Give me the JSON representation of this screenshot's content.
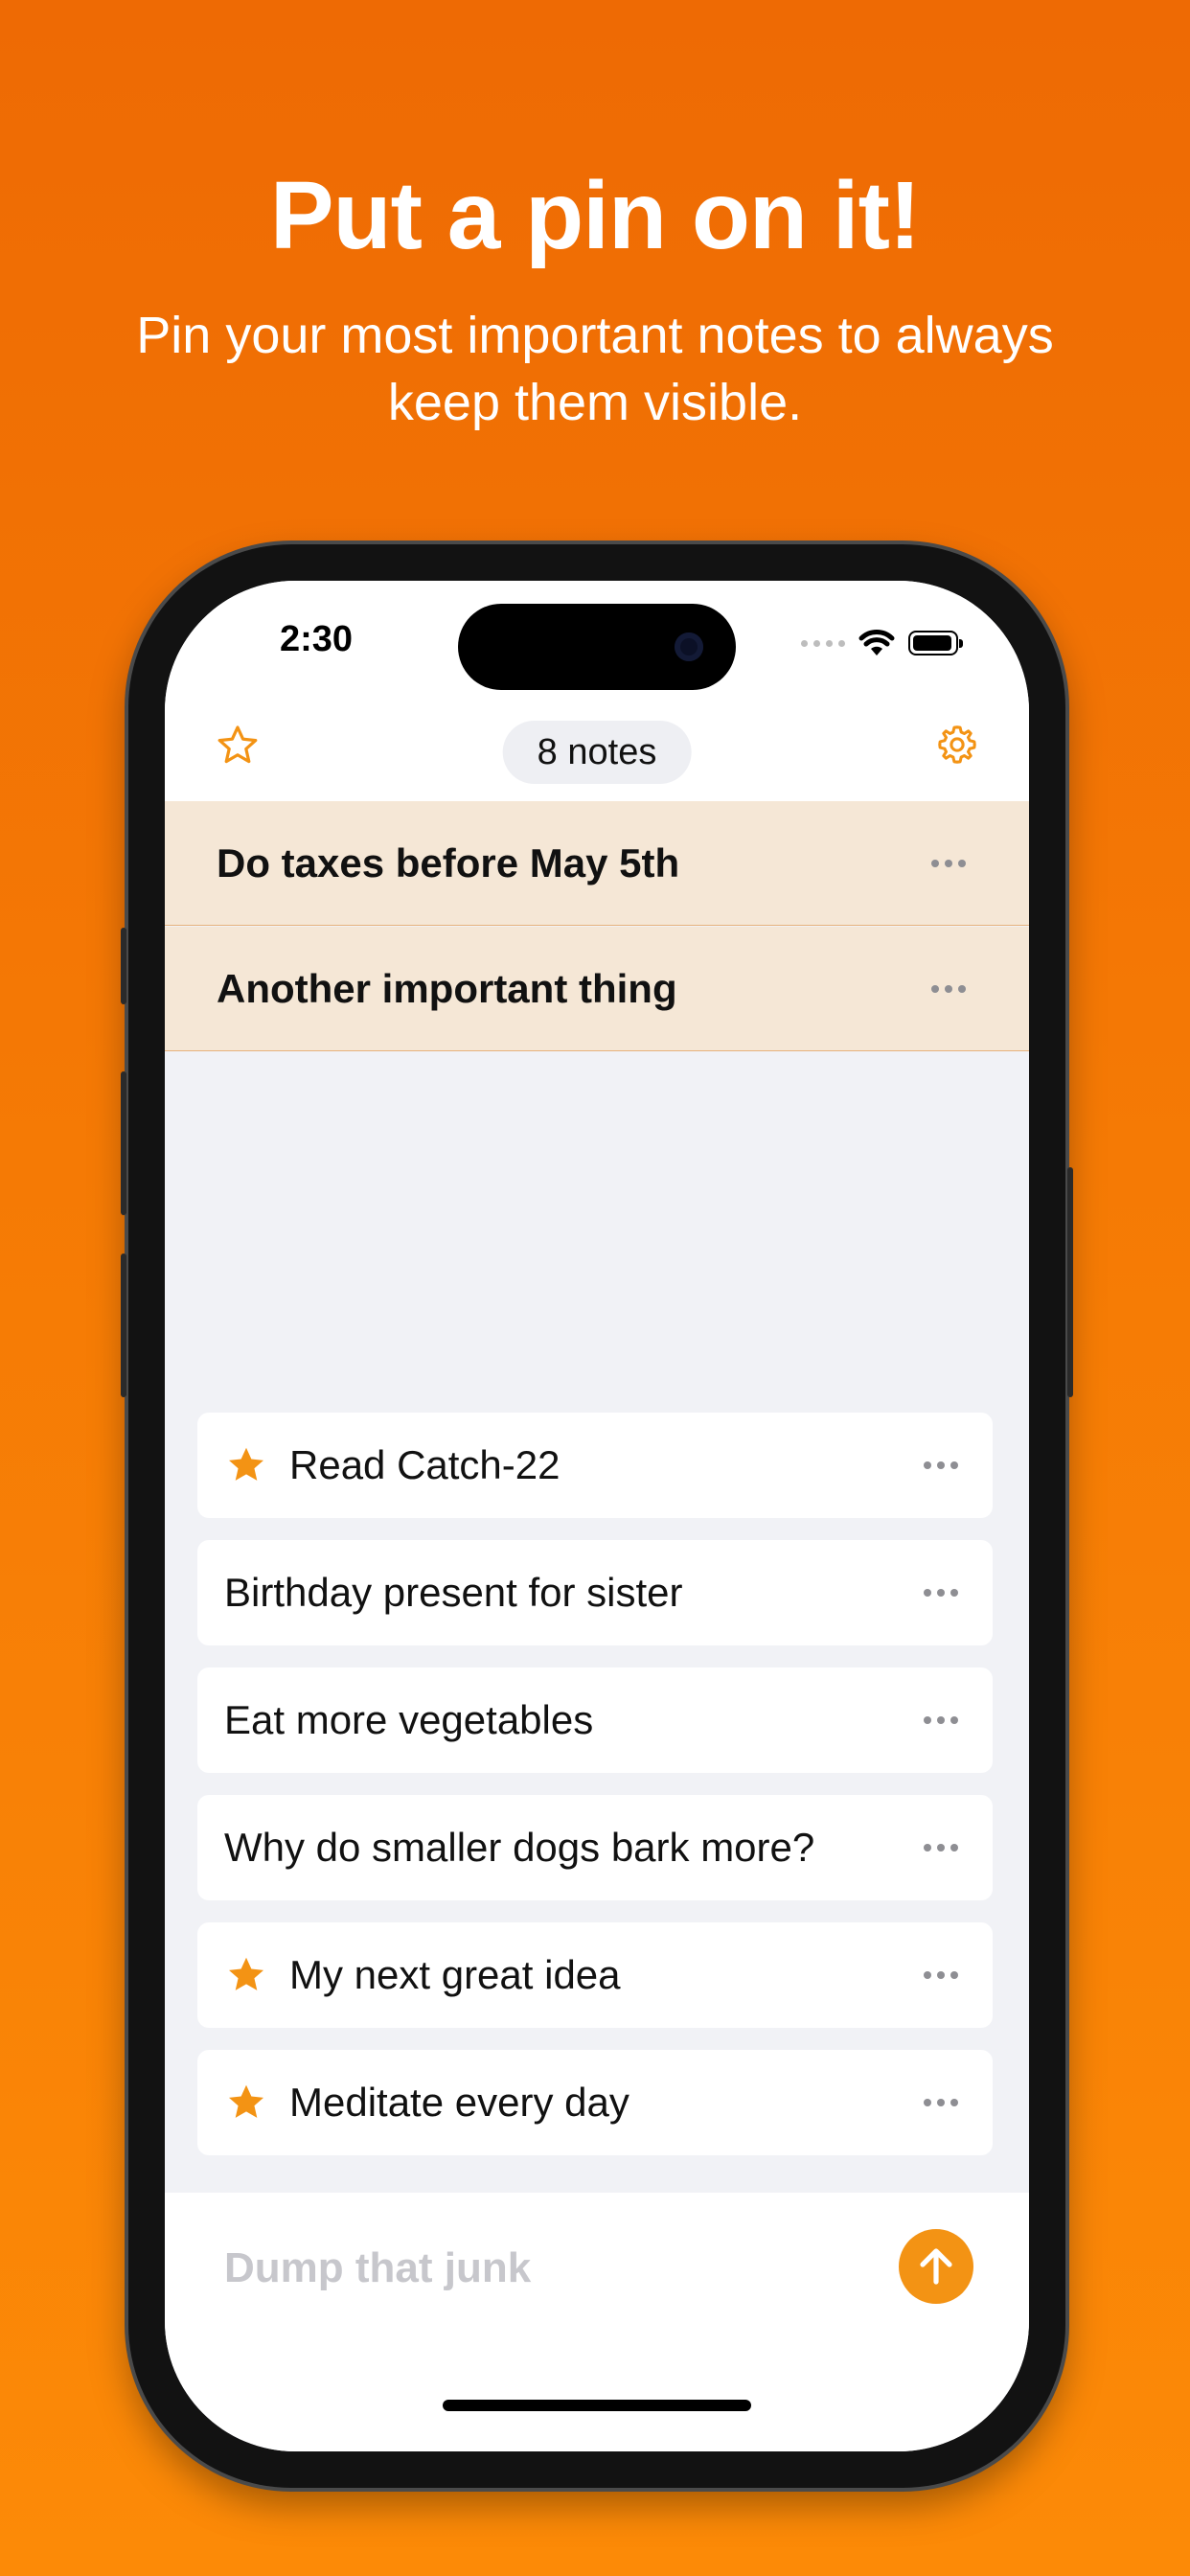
{
  "promo": {
    "headline": "Put a pin on it!",
    "subline": "Pin your most important notes to always keep them visible."
  },
  "status_bar": {
    "time": "2:30"
  },
  "toolbar": {
    "notes_count": "8 notes",
    "left_icon": "star-outline-icon",
    "right_icon": "gear-icon"
  },
  "pinned_notes": [
    {
      "text": "Do taxes before May 5th"
    },
    {
      "text": "Another important thing"
    }
  ],
  "notes": [
    {
      "text": "Read Catch-22",
      "starred": true
    },
    {
      "text": "Birthday present for sister",
      "starred": false
    },
    {
      "text": "Eat more vegetables",
      "starred": false
    },
    {
      "text": "Why do smaller dogs bark more?",
      "starred": false
    },
    {
      "text": "My next great idea",
      "starred": true
    },
    {
      "text": "Meditate every day",
      "starred": true
    }
  ],
  "composer": {
    "placeholder": "Dump that junk"
  },
  "colors": {
    "accent": "#F39314",
    "pinned_background": "#F5E7D6",
    "background_top": "#EE6A04",
    "background_bottom": "#FC8A07"
  }
}
